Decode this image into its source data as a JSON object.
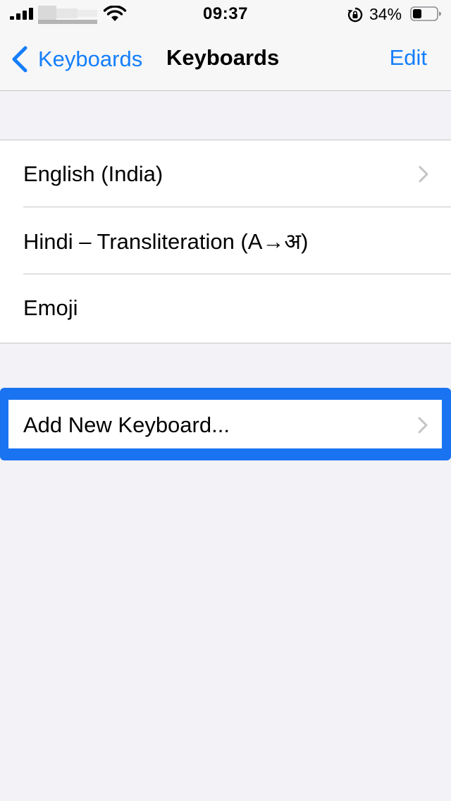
{
  "status_bar": {
    "time": "09:37",
    "battery_percent": "34%"
  },
  "nav": {
    "back_label": "Keyboards",
    "title": "Keyboards",
    "edit_label": "Edit"
  },
  "keyboards": [
    {
      "label": "English (India)",
      "has_chevron": true
    },
    {
      "label": "Hindi – Transliteration (A→अ)",
      "has_chevron": false
    },
    {
      "label": "Emoji",
      "has_chevron": false
    }
  ],
  "add_keyboard": {
    "label": "Add New Keyboard..."
  },
  "colors": {
    "accent": "#157efb",
    "highlight": "#1a73f0",
    "background": "#f2f2f7"
  }
}
